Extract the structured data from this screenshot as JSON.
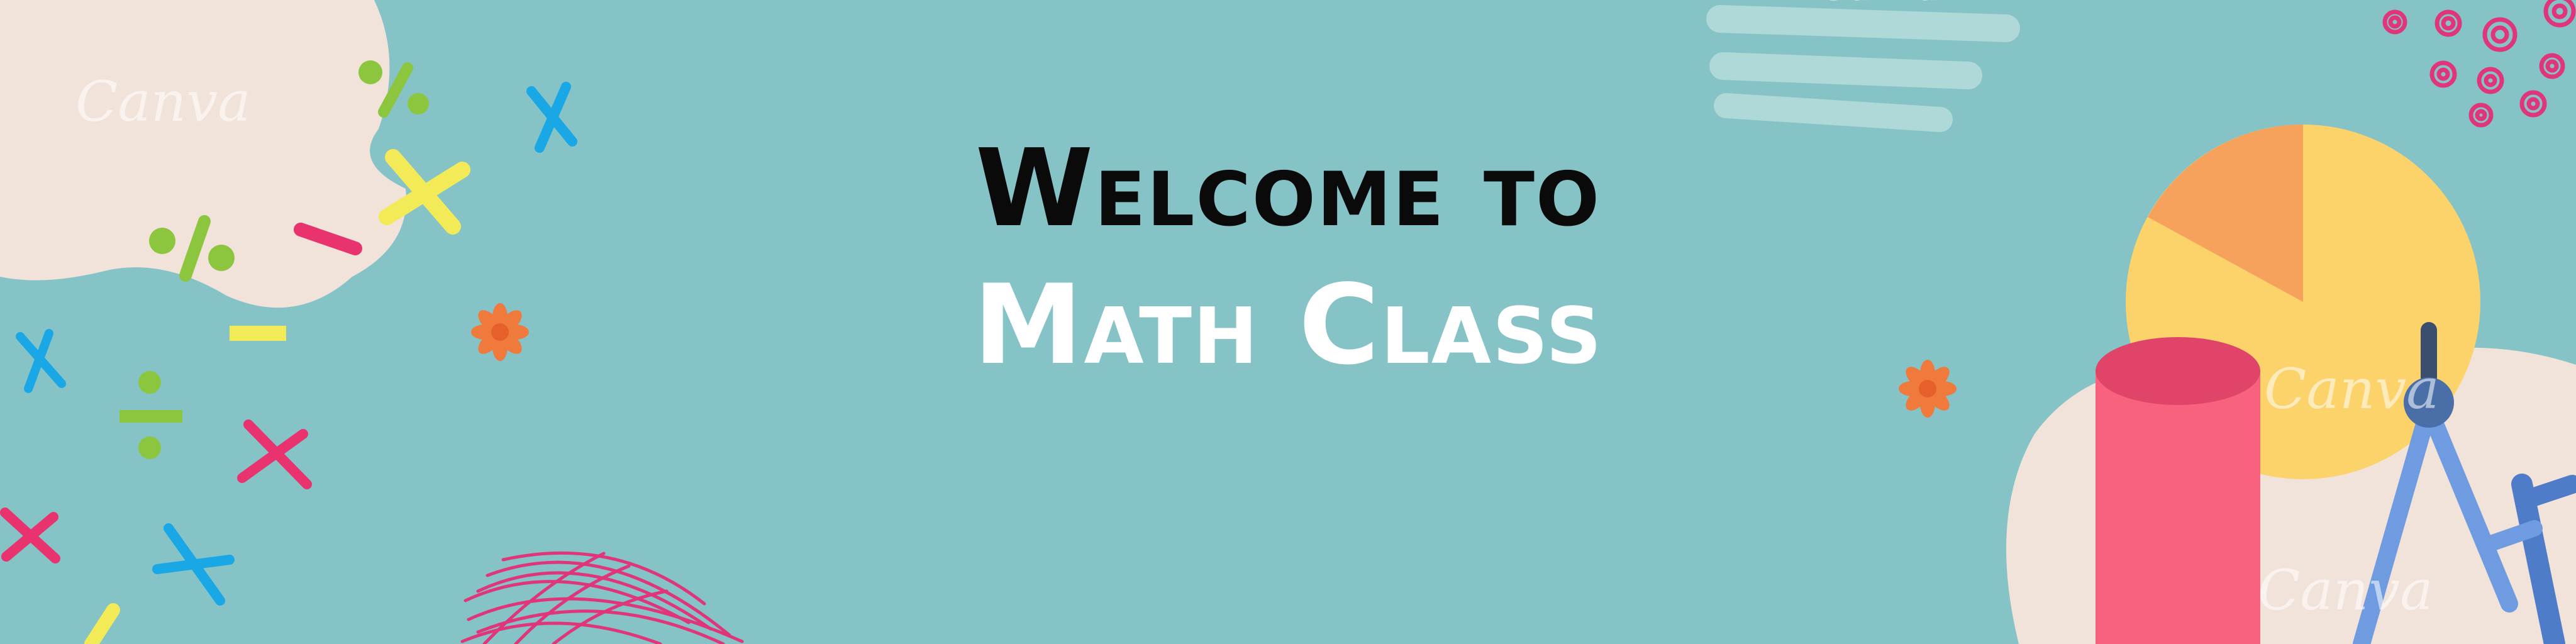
{
  "banner": {
    "title_line_1": "Welcome to",
    "title_line_2": "Math Class",
    "watermark": "Canva"
  },
  "icons": [
    "percent-symbol",
    "multiply-symbol",
    "minus-symbol",
    "divide-symbol",
    "flower",
    "scribble",
    "pie-chart",
    "cylinder",
    "drawing-compass",
    "swirls",
    "chalk-strokes"
  ],
  "colors": {
    "background": "#85c3c7",
    "blob": "#f1e3da",
    "title_dark": "#0a0a0a",
    "title_light": "#ffffff",
    "pink": "#e8336e",
    "yellow": "#f3ea58",
    "green": "#8cc63f",
    "blue": "#1aa7e6",
    "orange": "#f07a3b",
    "pie_yellow": "#fcd36a",
    "pie_orange": "#f6a25c",
    "cylinder": "#f9627f",
    "compass": "#6f9be0"
  }
}
